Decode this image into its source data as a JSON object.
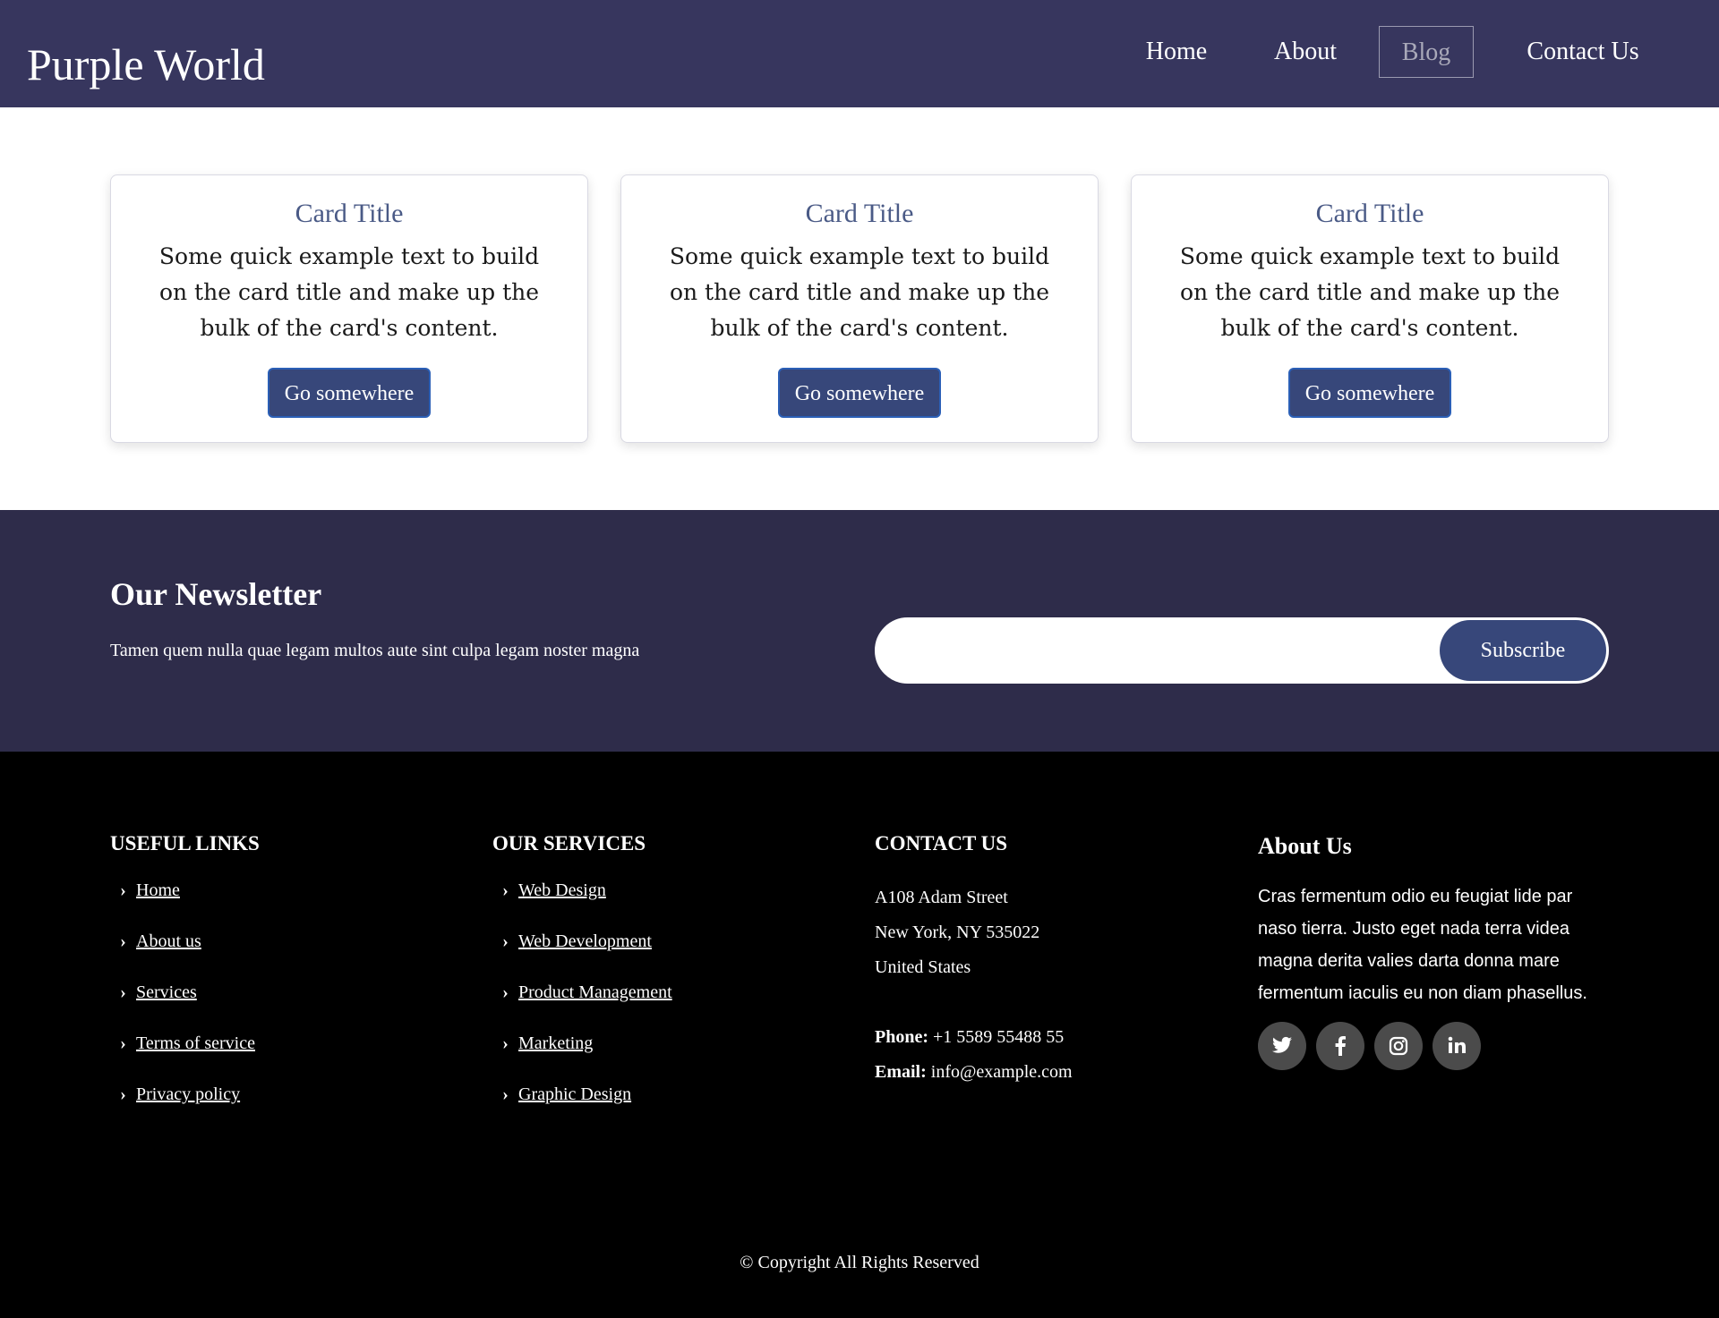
{
  "header": {
    "brand": "Purple World",
    "nav": [
      {
        "label": "Home",
        "active": false
      },
      {
        "label": "About",
        "active": false
      },
      {
        "label": "Blog",
        "active": true
      },
      {
        "label": "Contact Us",
        "active": false
      }
    ]
  },
  "cards": [
    {
      "title": "Card Title",
      "text": "Some quick example text to build on the card title and make up the bulk of the card's content.",
      "button": "Go somewhere"
    },
    {
      "title": "Card Title",
      "text": "Some quick example text to build on the card title and make up the bulk of the card's content.",
      "button": "Go somewhere"
    },
    {
      "title": "Card Title",
      "text": "Some quick example text to build on the card title and make up the bulk of the card's content.",
      "button": "Go somewhere"
    }
  ],
  "newsletter": {
    "title": "Our Newsletter",
    "text": "Tamen quem nulla quae legam multos aute sint culpa legam noster magna",
    "input_value": "",
    "button": "Subscribe"
  },
  "footer": {
    "useful_links": {
      "title": "USEFUL LINKS",
      "items": [
        "Home",
        "About us",
        "Services",
        "Terms of service",
        "Privacy policy"
      ]
    },
    "services": {
      "title": "OUR SERVICES",
      "items": [
        "Web Design",
        "Web Development",
        "Product Management",
        "Marketing",
        "Graphic Design"
      ]
    },
    "contact": {
      "title": "CONTACT US",
      "address": [
        "A108 Adam Street",
        "New York, NY 535022",
        "United States"
      ],
      "phone_label": "Phone:",
      "phone": "+1 5589 55488 55",
      "email_label": "Email:",
      "email": "info@example.com"
    },
    "about": {
      "title": "About Us",
      "text": "Cras fermentum odio eu feugiat lide par naso tierra. Justo eget nada terra videa magna derita valies darta donna mare fermentum iaculis eu non diam phasellus.",
      "socials": [
        "twitter-icon",
        "facebook-icon",
        "instagram-icon",
        "linkedin-icon"
      ]
    },
    "copyright": "© Copyright All Rights Reserved"
  },
  "colors": {
    "header_bg": "#37365e",
    "newsletter_bg": "#2e2c4a",
    "button_bg": "#37477a",
    "card_title": "#4a5a86",
    "footer_bg": "#000000"
  }
}
